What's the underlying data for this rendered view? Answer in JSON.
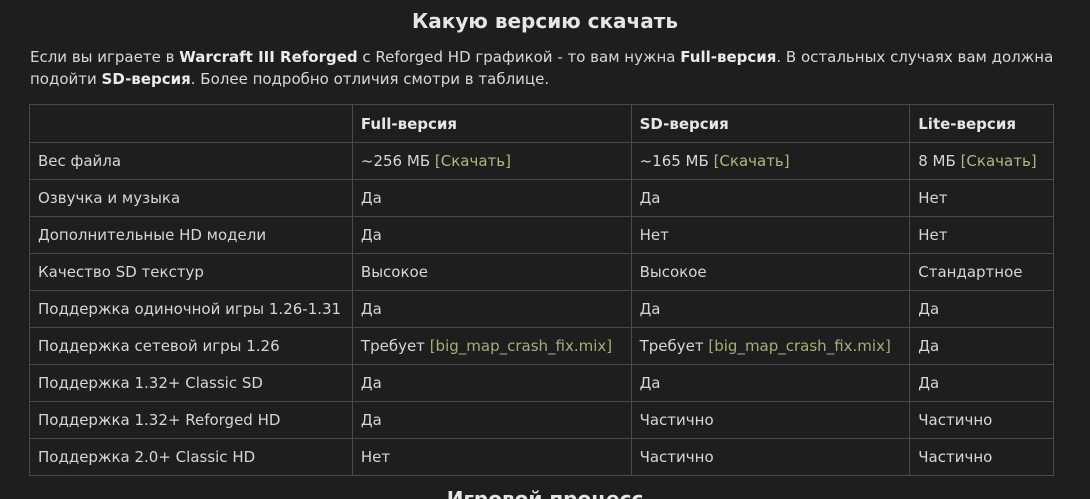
{
  "title": "Какую версию скачать",
  "intro": {
    "p1": "Если вы играете в ",
    "b1": "Warcraft III Reforged",
    "p2": " с Reforged HD графикой - то вам нужна ",
    "b2": "Full-версия",
    "p3": ". В остальных случаях вам должна подойти ",
    "b3": "SD-версия",
    "p4": ". Более подробно отличия смотри в таблице."
  },
  "table": {
    "headers": [
      "",
      "Full-версия",
      "SD-версия",
      "Lite-версия"
    ],
    "size_row": {
      "label": "Вес файла",
      "full": "~256 МБ",
      "sd": "~165 МБ",
      "lite": "8 МБ",
      "download_link": "[Скачать]"
    },
    "rows": [
      [
        "Озвучка и музыка",
        "Да",
        "Да",
        "Нет"
      ],
      [
        "Дополнительные HD модели",
        "Да",
        "Нет",
        "Нет"
      ],
      [
        "Качество SD текстур",
        "Высокое",
        "Высокое",
        "Стандартное"
      ],
      [
        "Поддержка одиночной игры 1.26-1.31",
        "Да",
        "Да",
        "Да"
      ]
    ],
    "network_row": {
      "label": "Поддержка сетевой игры 1.26",
      "requires": "Требует",
      "file_link": "[big_map_crash_fix.mix]",
      "lite": "Да"
    },
    "rows2": [
      [
        "Поддержка 1.32+ Classic SD",
        "Да",
        "Да",
        "Да"
      ],
      [
        "Поддержка 1.32+ Reforged HD",
        "Да",
        "Частично",
        "Частично"
      ],
      [
        "Поддержка 2.0+ Classic HD",
        "Нет",
        "Частично",
        "Частично"
      ]
    ]
  },
  "next_heading": "Игровой процесс",
  "colors": {
    "background": "#1e1e1e",
    "text": "#d6d6d6",
    "border": "#4a4a4a",
    "link": "#b7b480"
  }
}
